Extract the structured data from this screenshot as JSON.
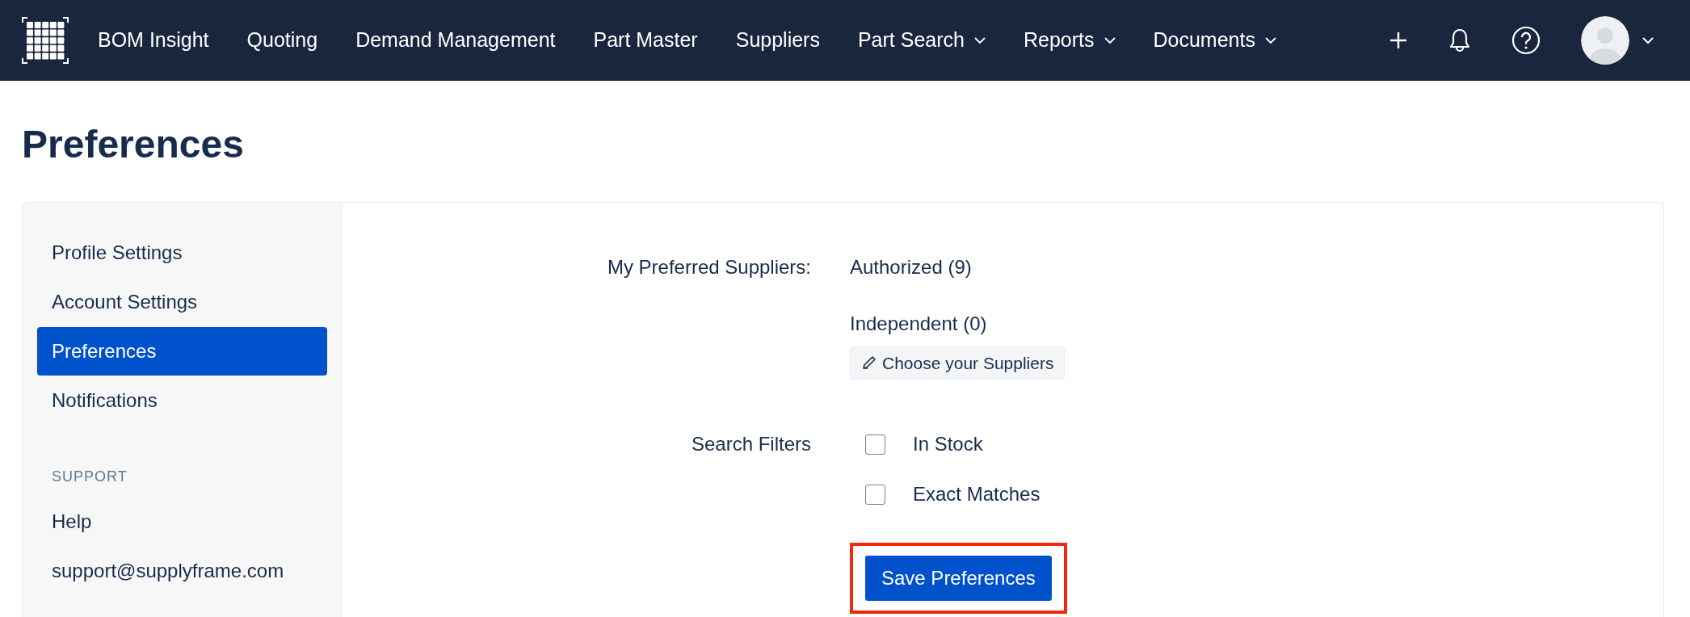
{
  "navbar": {
    "items": [
      {
        "label": "BOM Insight",
        "dropdown": false
      },
      {
        "label": "Quoting",
        "dropdown": false
      },
      {
        "label": "Demand Management",
        "dropdown": false
      },
      {
        "label": "Part Master",
        "dropdown": false
      },
      {
        "label": "Suppliers",
        "dropdown": false
      },
      {
        "label": "Part Search",
        "dropdown": true
      },
      {
        "label": "Reports",
        "dropdown": true
      },
      {
        "label": "Documents",
        "dropdown": true
      }
    ]
  },
  "page_title": "Preferences",
  "sidebar": {
    "groups": [
      {
        "items": [
          {
            "label": "Profile Settings",
            "selected": false
          },
          {
            "label": "Account Settings",
            "selected": false
          },
          {
            "label": "Preferences",
            "selected": true
          },
          {
            "label": "Notifications",
            "selected": false
          }
        ]
      },
      {
        "heading": "SUPPORT",
        "items": [
          {
            "label": "Help",
            "selected": false
          },
          {
            "label": "support@supplyframe.com",
            "selected": false
          }
        ]
      }
    ]
  },
  "preferred_suppliers": {
    "label": "My Preferred Suppliers:",
    "values": [
      "Authorized (9)",
      "Independent (0)"
    ],
    "button": "Choose your Suppliers"
  },
  "search_filters": {
    "label": "Search Filters",
    "options": [
      {
        "label": "In Stock",
        "checked": false
      },
      {
        "label": "Exact Matches",
        "checked": false
      }
    ]
  },
  "save_button": {
    "label": "Save Preferences",
    "highlighted": true
  }
}
